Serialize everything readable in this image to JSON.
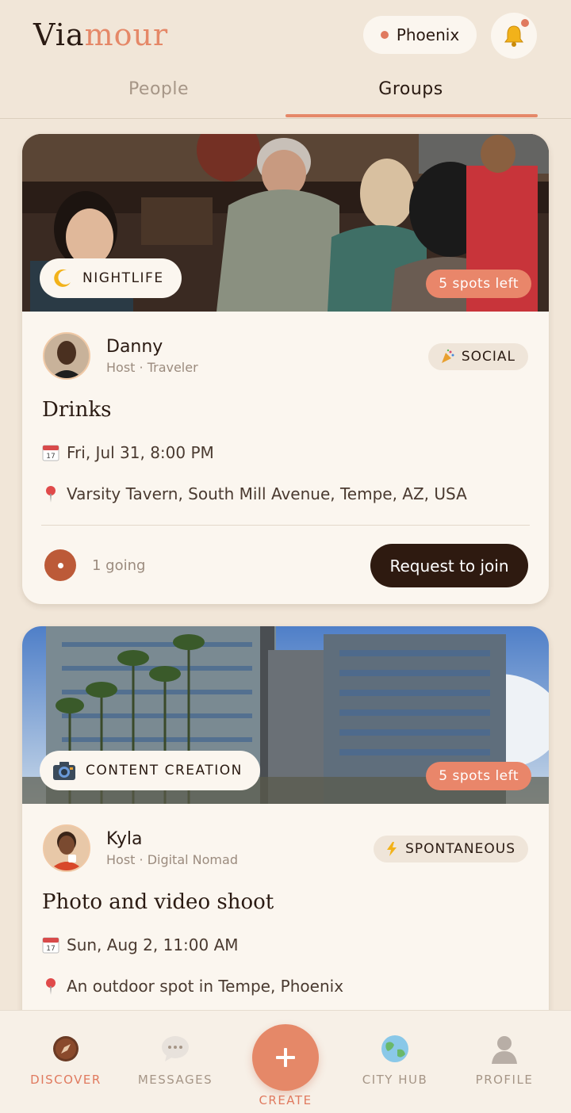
{
  "app": {
    "logo_part1": "Via",
    "logo_part2": "mour",
    "city": "Phoenix"
  },
  "tabs": [
    {
      "label": "People",
      "active": false
    },
    {
      "label": "Groups",
      "active": true
    }
  ],
  "cards": [
    {
      "category": "NIGHTLIFE",
      "category_icon": "moon-icon",
      "spots": "5 spots left",
      "host_name": "Danny",
      "host_role": "Host · Traveler",
      "vibe": "SOCIAL",
      "vibe_icon": "party-popper-icon",
      "title": "Drinks",
      "date": "Fri, Jul 31, 8:00 PM",
      "location": "Varsity Tavern, South Mill Avenue, Tempe, AZ, USA",
      "going": "1 going",
      "join_label": "Request to join"
    },
    {
      "category": "CONTENT CREATION",
      "category_icon": "camera-icon",
      "spots": "5 spots left",
      "host_name": "Kyla",
      "host_role": "Host · Digital Nomad",
      "vibe": "SPONTANEOUS",
      "vibe_icon": "lightning-icon",
      "title": "Photo and video shoot",
      "date": "Sun, Aug 2, 11:00 AM",
      "location": "An outdoor spot in Tempe, Phoenix"
    }
  ],
  "nav": {
    "discover": "DISCOVER",
    "messages": "MESSAGES",
    "create": "CREATE",
    "city_hub": "CITY HUB",
    "profile": "PROFILE"
  },
  "colors": {
    "background": "#f1e6d8",
    "accent": "#e58868",
    "dark": "#2e1a10",
    "card": "#fbf6ef"
  }
}
